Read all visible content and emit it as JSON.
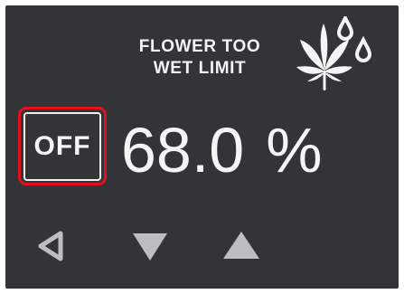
{
  "setting": {
    "title_line1": "FLOWER TOO",
    "title_line2": "WET LIMIT",
    "icon": "cannabis-leaf-water-drops-icon"
  },
  "off_button": {
    "label": "OFF",
    "highlight_color": "#e0101f"
  },
  "reading": {
    "value": "68.0",
    "unit": "%"
  },
  "nav": {
    "back_icon": "back-triangle-icon",
    "down_icon": "down-triangle-icon",
    "up_icon": "up-triangle-icon"
  },
  "colors": {
    "background": "#333438",
    "text": "#f5f5f5",
    "nav_icon": "#bdbec3"
  }
}
